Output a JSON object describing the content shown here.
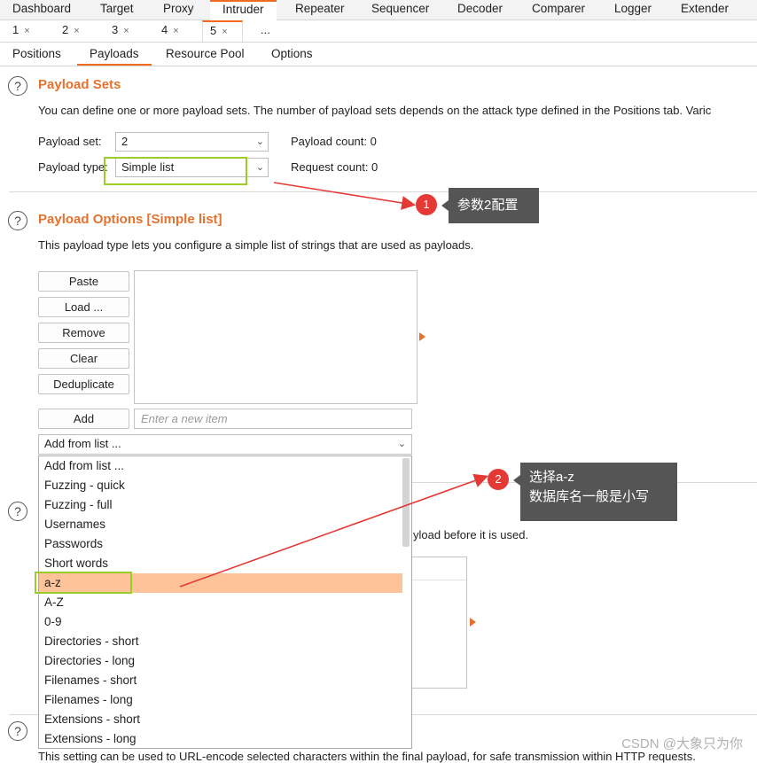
{
  "top_tabs": [
    "Dashboard",
    "Target",
    "Proxy",
    "Intruder",
    "Repeater",
    "Sequencer",
    "Decoder",
    "Comparer",
    "Logger",
    "Extender"
  ],
  "active_top_tab": "Intruder",
  "number_tabs": [
    "1",
    "2",
    "3",
    "4",
    "5",
    "..."
  ],
  "number_tab_close": "×",
  "sub_tabs": [
    "Positions",
    "Payloads",
    "Resource Pool",
    "Options"
  ],
  "help_glyph": "?",
  "payload_sets": {
    "title": "Payload Sets",
    "description": "You can define one or more payload sets. The number of payload sets depends on the attack type defined in the Positions tab. Varic",
    "set_label": "Payload set:",
    "set_value": "2",
    "type_label": "Payload type:",
    "type_value": "Simple list",
    "payload_count": "Payload count: 0",
    "request_count": "Request count: 0"
  },
  "payload_options": {
    "title": "Payload Options [Simple list]",
    "description": "This payload type lets you configure a simple list of strings that are used as payloads.",
    "buttons": [
      "Paste",
      "Load ...",
      "Remove",
      "Clear",
      "Deduplicate"
    ],
    "add_button": "Add",
    "add_placeholder": "Enter a new item",
    "add_from_list": "Add from list ..."
  },
  "dropdown_items": [
    "Add from list ...",
    "Fuzzing - quick",
    "Fuzzing - full",
    "Usernames",
    "Passwords",
    "Short words",
    "a-z",
    "A-Z",
    "0-9",
    "Directories - short",
    "Directories - long",
    "Filenames - short",
    "Filenames - long",
    "Extensions - short",
    "Extensions - long"
  ],
  "selected_dropdown_item": "a-z",
  "processing_fragment": "yload before it is used.",
  "encoding_fragment": "This setting can be used to URL-encode selected characters within the final payload, for safe transmission within HTTP requests.",
  "annotations": {
    "badge1": "1",
    "callout1": "参数2配置",
    "badge2": "2",
    "callout2_line1": "选择a-z",
    "callout2_line2": "数据库名一般是小写"
  },
  "watermark": "CSDN @大象只为你",
  "colors": {
    "accent": "#e4722f",
    "highlight": "#ffc39a",
    "annotation_green": "#9ccc2a",
    "annotation_red": "#e53935",
    "callout_bg": "#555555"
  }
}
